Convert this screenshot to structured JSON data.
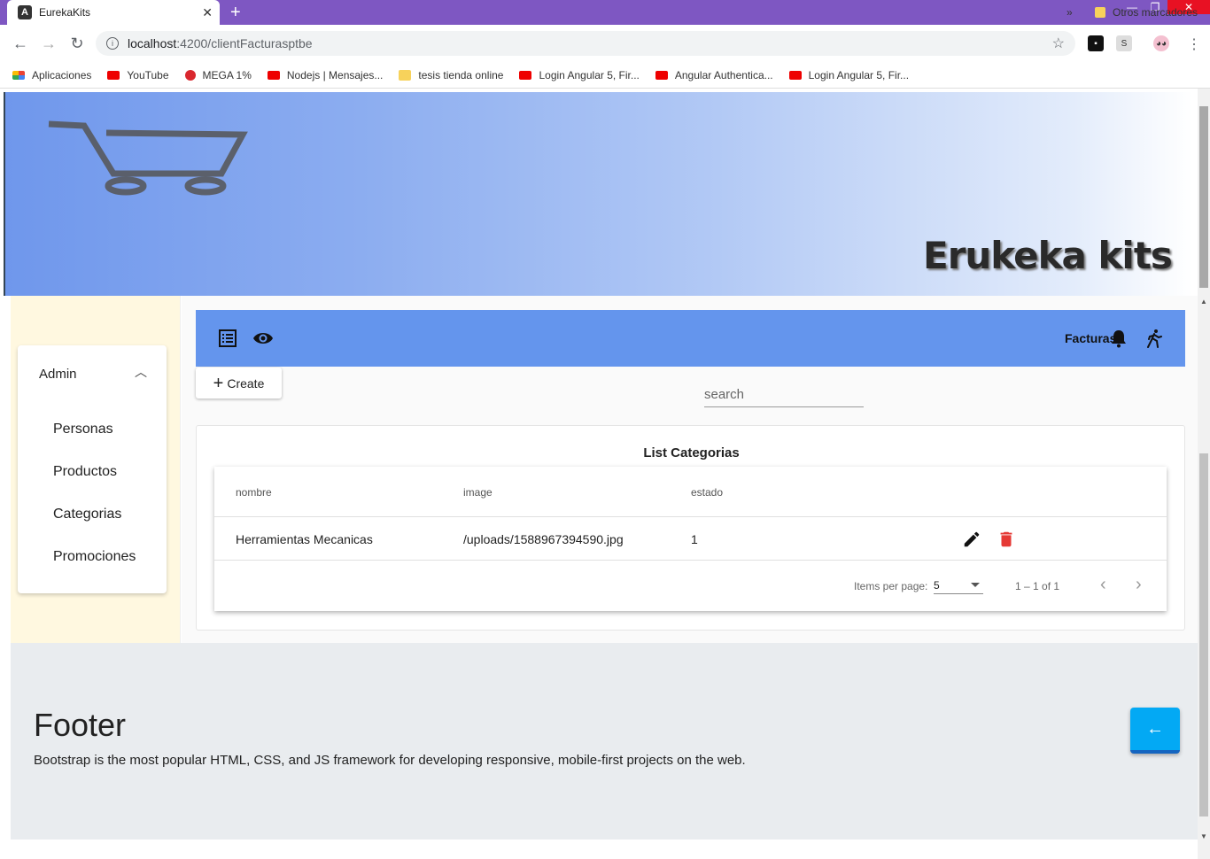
{
  "browser": {
    "tab_title": "EurekaKits",
    "tab_favicon": "angular-icon",
    "url_host": "localhost",
    "url_rest": ":4200/clientFacturasptbe",
    "bookmarks": [
      {
        "label": "Aplicaciones",
        "icon": "apps"
      },
      {
        "label": "YouTube",
        "icon": "yt"
      },
      {
        "label": "MEGA 1%",
        "icon": "mega"
      },
      {
        "label": "Nodejs | Mensajes...",
        "icon": "yt"
      },
      {
        "label": "tesis tienda online",
        "icon": "folder"
      },
      {
        "label": "Login Angular 5, Fir...",
        "icon": "yt"
      },
      {
        "label": "Angular Authentica...",
        "icon": "yt"
      },
      {
        "label": "Login Angular 5, Fir...",
        "icon": "yt"
      }
    ],
    "bookmarks_more": "»",
    "other_bookmarks": "Otros marcadores",
    "ext2_label": "S"
  },
  "hero": {
    "brand": "Erukeka kits"
  },
  "sidebar": {
    "header": "Admin",
    "items": [
      {
        "label": "Personas"
      },
      {
        "label": "Productos"
      },
      {
        "label": "Categorias"
      },
      {
        "label": "Promociones"
      }
    ]
  },
  "toolbar": {
    "label": "Facturas"
  },
  "actions": {
    "create_label": "Create",
    "search_placeholder": "search"
  },
  "table": {
    "title": "List Categorias",
    "columns": [
      "nombre",
      "image",
      "estado"
    ],
    "rows": [
      {
        "nombre": "Herramientas Mecanicas",
        "image": "/uploads/1588967394590.jpg",
        "estado": "1"
      }
    ],
    "pager": {
      "items_per_page_label": "Items per page:",
      "items_per_page": "5",
      "range": "1 – 1 of 1"
    }
  },
  "footer": {
    "title": "Footer",
    "text": "Bootstrap is the most popular HTML, CSS, and JS framework for developing responsive, mobile-first projects on the web."
  },
  "colors": {
    "tabbar": "#7e57c2",
    "toolbar": "#6495ed",
    "sidebar_bg": "#fff8e0",
    "footer_bg": "#e9ecef",
    "back_button": "#03a9f4",
    "delete_icon": "#e53935"
  }
}
